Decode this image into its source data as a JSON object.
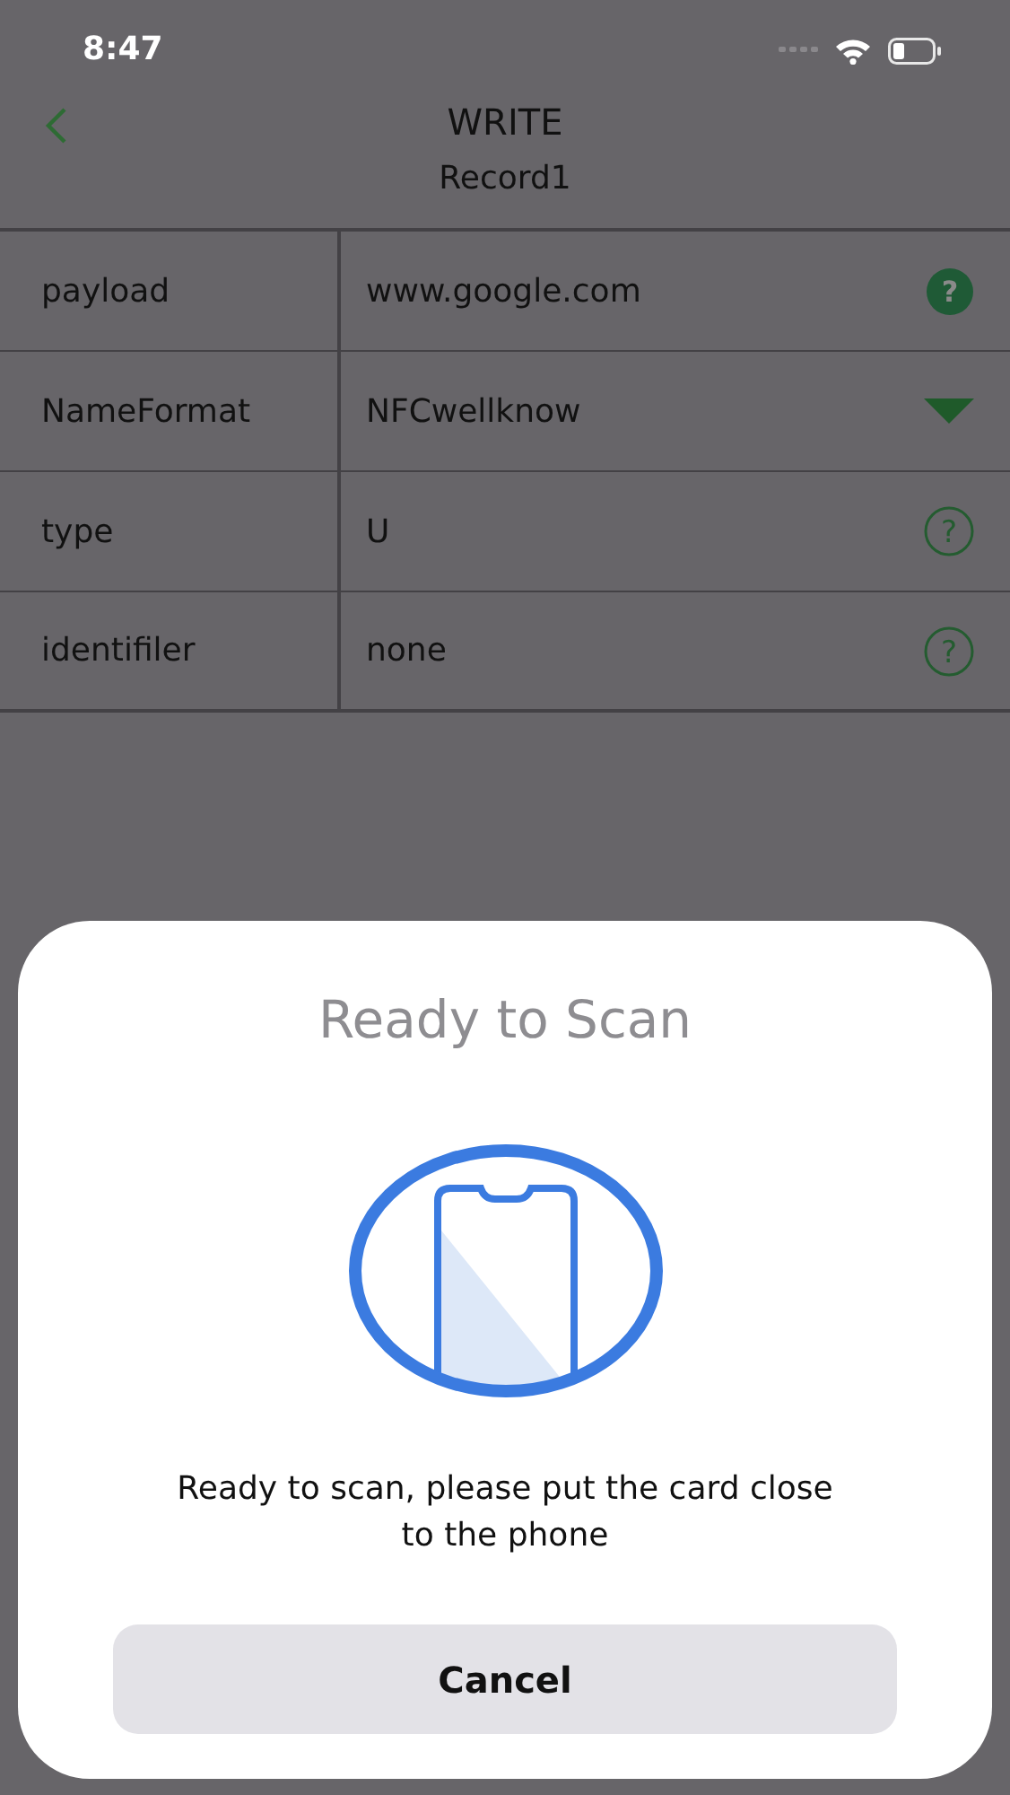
{
  "status_bar": {
    "time": "8:47"
  },
  "nav": {
    "title": "WRITE",
    "subtitle": "Record1"
  },
  "fields": [
    {
      "label": "payload",
      "value": "www.google.com",
      "kind": "help-filled",
      "icon": "?"
    },
    {
      "label": "NameFormat",
      "value": "NFCwellknow",
      "kind": "dropdown"
    },
    {
      "label": "type",
      "value": "U",
      "kind": "help-outline",
      "icon": "?"
    },
    {
      "label": "identifiler",
      "value": "none",
      "kind": "help-outline",
      "icon": "?"
    }
  ],
  "scan_sheet": {
    "title": "Ready to Scan",
    "message": "Ready to scan, please put the card close to the phone",
    "cancel": "Cancel"
  }
}
